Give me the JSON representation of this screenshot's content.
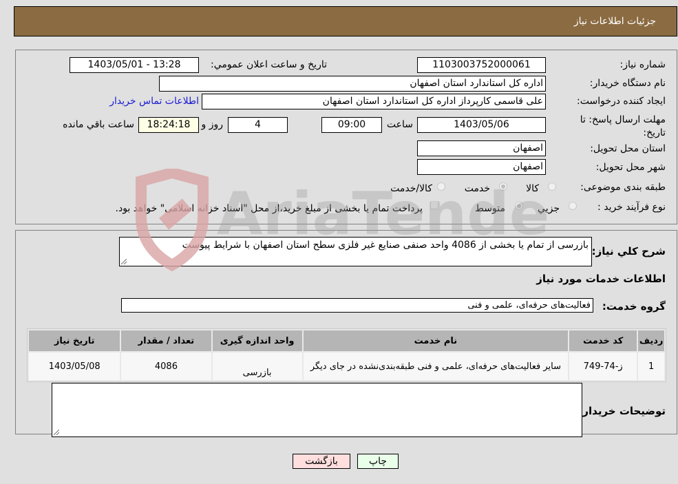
{
  "header": {
    "title": "جزئیات اطلاعات نیاز"
  },
  "fields": {
    "need_number": {
      "label": "شماره نیاز:",
      "value": "1103003752000061"
    },
    "announce_datetime": {
      "label": "تاریخ و ساعت اعلان عمومي:",
      "value": "1403/05/01 - 13:28"
    },
    "buyer_org": {
      "label": "نام دستگاه خریدار:",
      "value": "اداره کل استاندارد استان اصفهان"
    },
    "requester": {
      "label": "ایجاد کننده درخواست:",
      "value": "علی قاسمی کارپرداز اداره کل استاندارد استان اصفهان"
    },
    "buyer_contact_link": "اطلاعات تماس خریدار",
    "deadline": {
      "label": "مهلت ارسال پاسخ: تا تاریخ:",
      "date": "1403/05/06",
      "time_label": "ساعت",
      "time": "09:00",
      "days": "4",
      "days_label": "روز و",
      "remaining": "18:24:18",
      "remaining_label": "ساعت باقي مانده"
    },
    "delivery_province": {
      "label": "استان محل تحویل:",
      "value": "اصفهان"
    },
    "delivery_city": {
      "label": "شهر محل تحویل:",
      "value": "اصفهان"
    },
    "category": {
      "label": "طبقه بندی موضوعی:",
      "options": [
        "کالا",
        "خدمت",
        "کالا/خدمت"
      ],
      "selected": "خدمت"
    },
    "purchase_type": {
      "label": "نوع فرآیند خرید :",
      "options": [
        "جزیي",
        "متوسط"
      ],
      "selected": "متوسط",
      "treasury_note": "پرداخت تمام یا بخشی از مبلغ خرید،از محل \"اسناد خزانه اسلامی\" خواهد بود."
    }
  },
  "description": {
    "label": "شرح کلي نیاز:",
    "value": "بازرسی از تمام یا بخشی از 4086 واحد صنفی صنایع غیر فلزی سطح استان اصفهان با شرایط پیوست"
  },
  "services_section": {
    "title": "اطلاعات خدمات مورد نیاز",
    "group_label": "گروه خدمت:",
    "group_value": "فعالیت‌های حرفه‌ای، علمی و فنی"
  },
  "table": {
    "headers": [
      "ردیف",
      "کد خدمت",
      "نام خدمت",
      "واحد اندازه گیری",
      "تعداد / مقدار",
      "تاریخ نیاز"
    ],
    "rows": [
      [
        "1",
        "ز-74-749",
        "سایر فعالیت‌های حرفه‌ای، علمی و فنی طبقه‌بندی‌نشده در جای دیگر",
        "بازرسی",
        "4086",
        "1403/05/08"
      ]
    ]
  },
  "buyer_notes": {
    "label": "توضیحات خریدار:",
    "value": ""
  },
  "buttons": {
    "print": "چاپ",
    "back": "بازگشت"
  },
  "watermark": "AriaTender.neT",
  "colors": {
    "header_bg": "#8b6b42",
    "print_bg": "#eaffea",
    "back_bg": "#ffdede",
    "link": "#1a1ad6"
  }
}
